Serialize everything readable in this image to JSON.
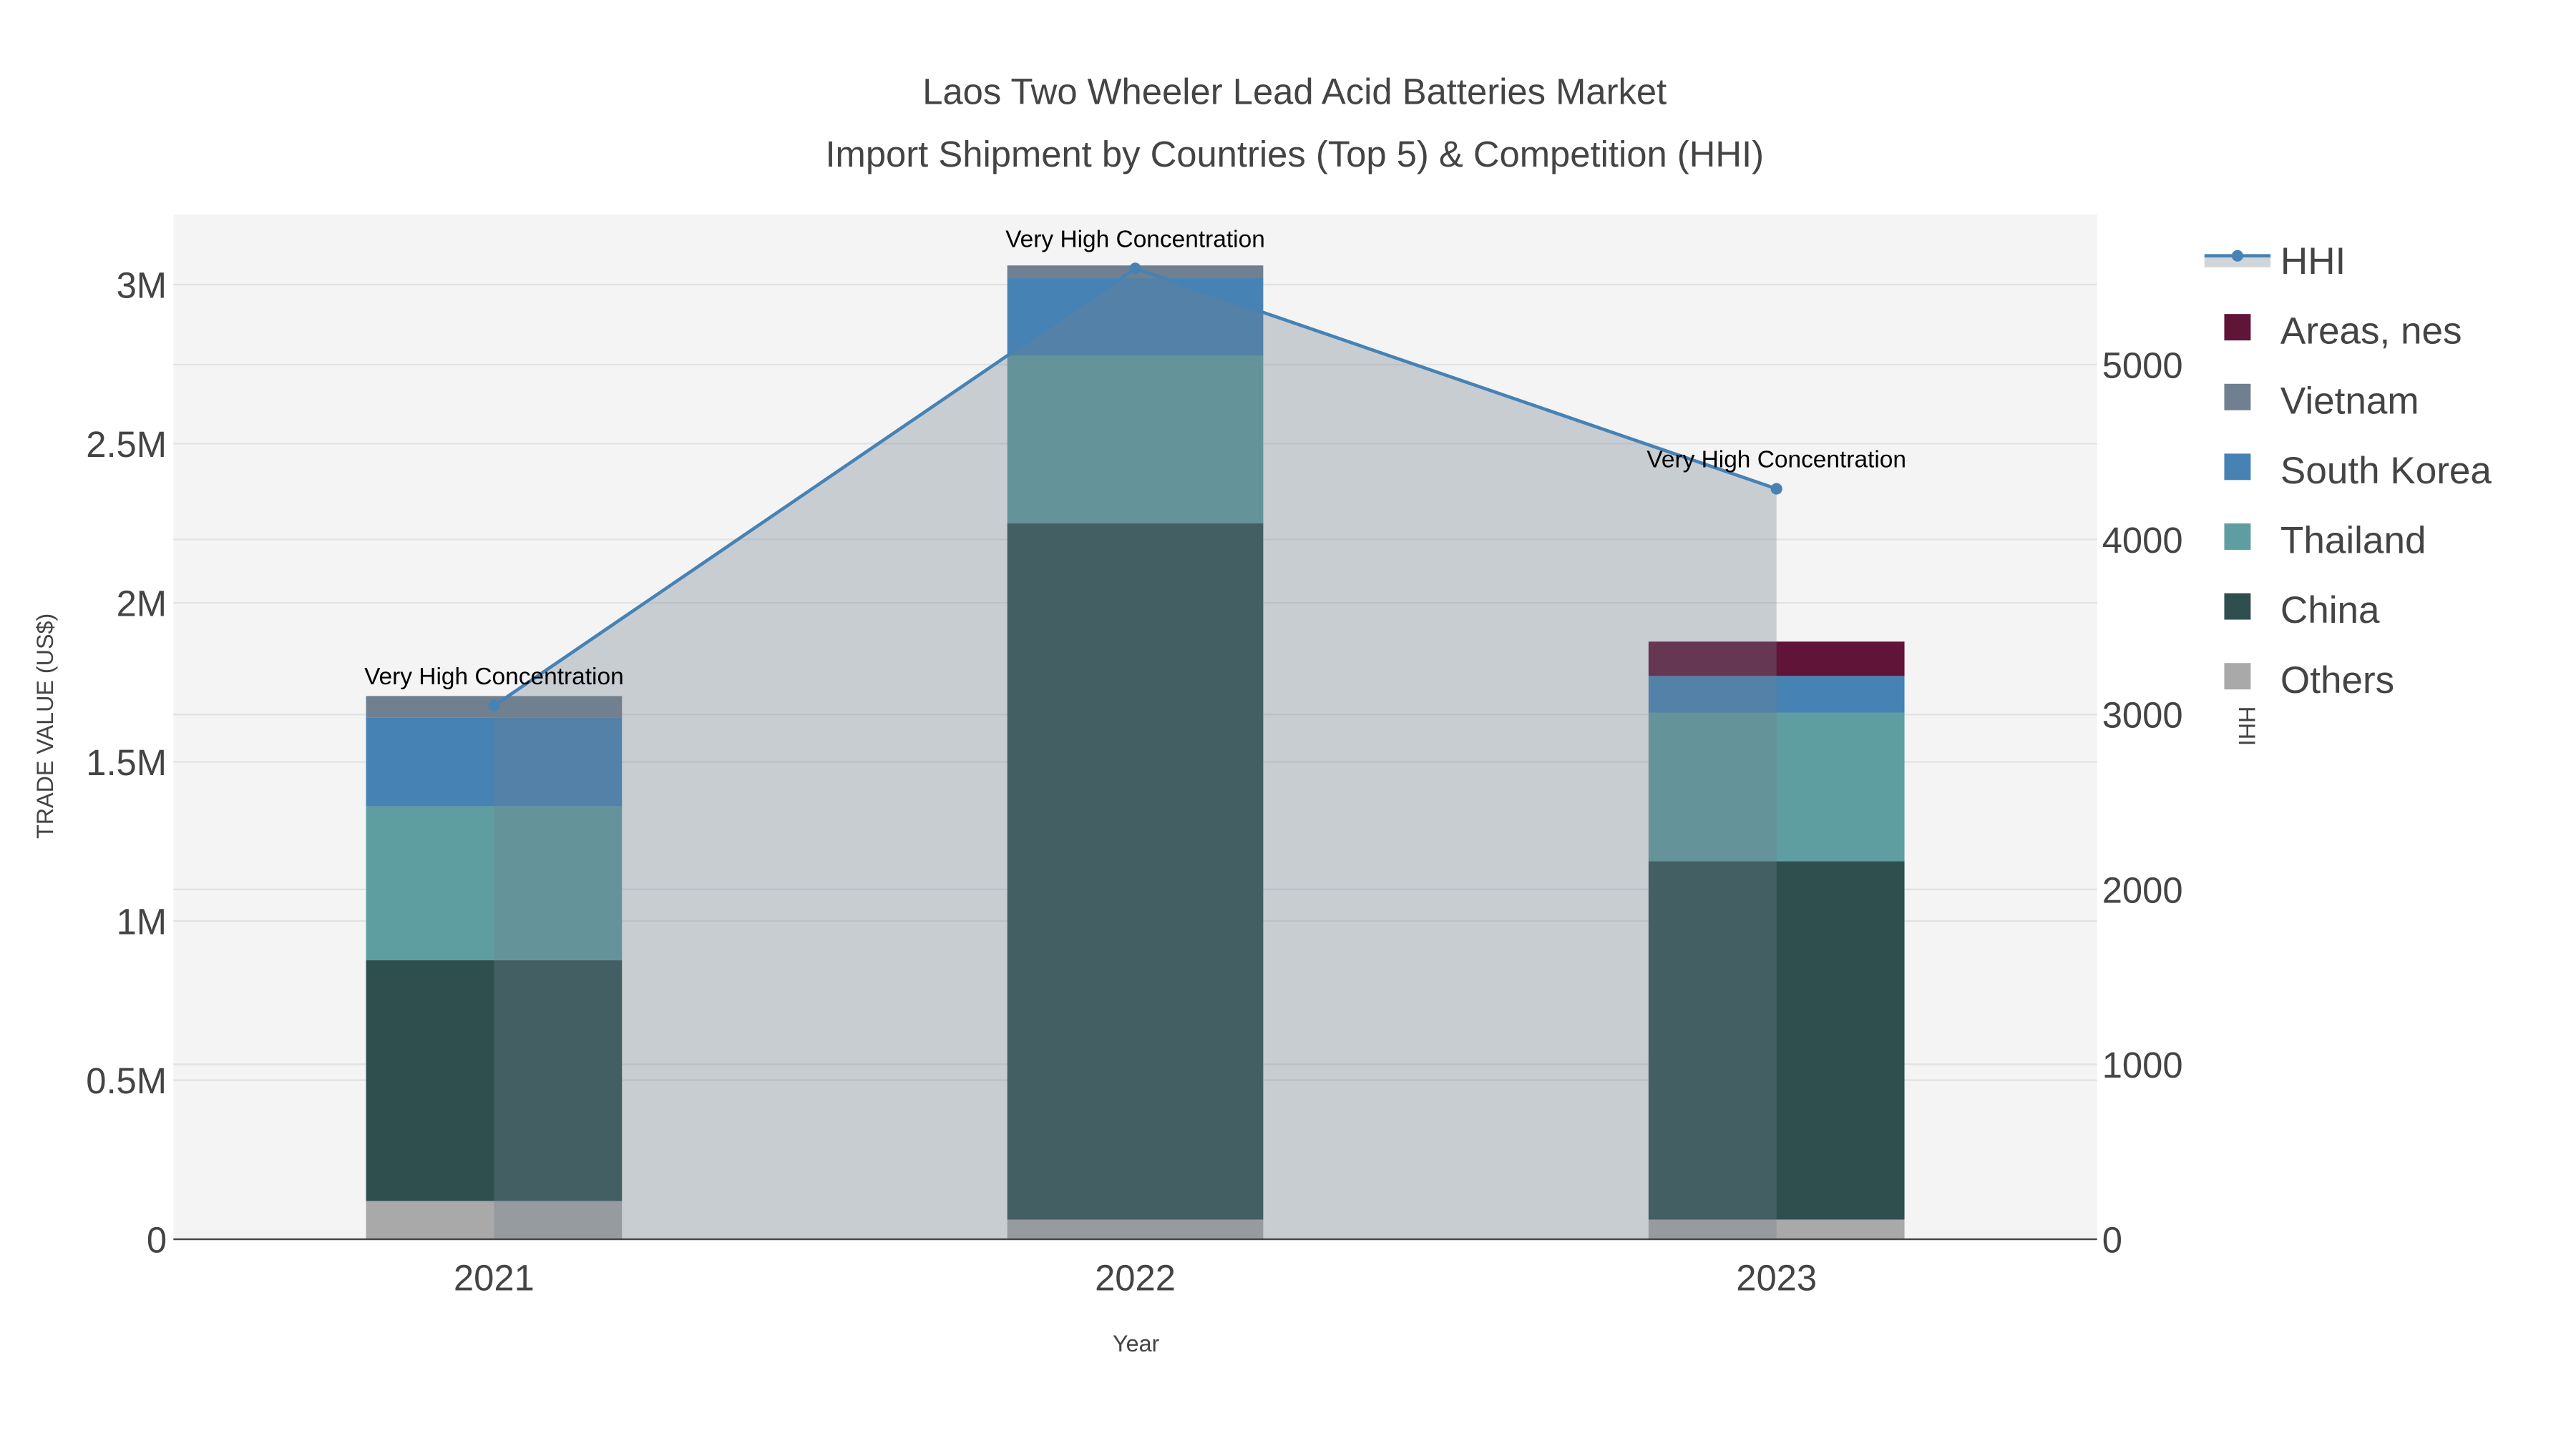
{
  "chart_data": {
    "type": "bar",
    "title_line1": "Laos Two Wheeler Lead Acid Batteries Market",
    "title_line2": "Import Shipment by Countries (Top 5) & Competition (HHI)",
    "xlabel": "Year",
    "ylabel": "TRADE VALUE (US$)",
    "y2label": "HHI",
    "categories": [
      "2021",
      "2022",
      "2023"
    ],
    "ylim": [
      0,
      3220000
    ],
    "y2lim": [
      0,
      5858
    ],
    "yticks": [
      {
        "v": 0,
        "label": "0"
      },
      {
        "v": 500000,
        "label": "0.5M"
      },
      {
        "v": 1000000,
        "label": "1M"
      },
      {
        "v": 1500000,
        "label": "1.5M"
      },
      {
        "v": 2000000,
        "label": "2M"
      },
      {
        "v": 2500000,
        "label": "2.5M"
      },
      {
        "v": 3000000,
        "label": "3M"
      }
    ],
    "y2ticks": [
      {
        "v": 0,
        "label": "0"
      },
      {
        "v": 1000,
        "label": "1000"
      },
      {
        "v": 2000,
        "label": "2000"
      },
      {
        "v": 3000,
        "label": "3000"
      },
      {
        "v": 4000,
        "label": "4000"
      },
      {
        "v": 5000,
        "label": "5000"
      }
    ],
    "grid": true,
    "legend_position": "right",
    "series": [
      {
        "name": "Others",
        "color": "#a9a9a9",
        "values": [
          120000,
          62000,
          62000
        ]
      },
      {
        "name": "China",
        "color": "#2f4f4f",
        "values": [
          757000,
          2188000,
          1126000
        ]
      },
      {
        "name": "Thailand",
        "color": "#5f9ea0",
        "values": [
          483000,
          526000,
          467000
        ]
      },
      {
        "name": "South Korea",
        "color": "#4682b4",
        "values": [
          280000,
          244000,
          115000
        ]
      },
      {
        "name": "Vietnam",
        "color": "#708090",
        "values": [
          67000,
          40000,
          0
        ]
      },
      {
        "name": "Areas, nes",
        "color": "#601437",
        "values": [
          0,
          0,
          108000
        ]
      }
    ],
    "hhi": {
      "name": "HHI",
      "color": "#4682b4",
      "fill": "rgba(112,128,144,0.33)",
      "values": [
        3050,
        5550,
        4290
      ]
    },
    "annotations": [
      "Very High Concentration",
      "Very High Concentration",
      "Very High Concentration"
    ],
    "legend_order": [
      "HHI",
      "Areas, nes",
      "Vietnam",
      "South Korea",
      "Thailand",
      "China",
      "Others"
    ]
  }
}
